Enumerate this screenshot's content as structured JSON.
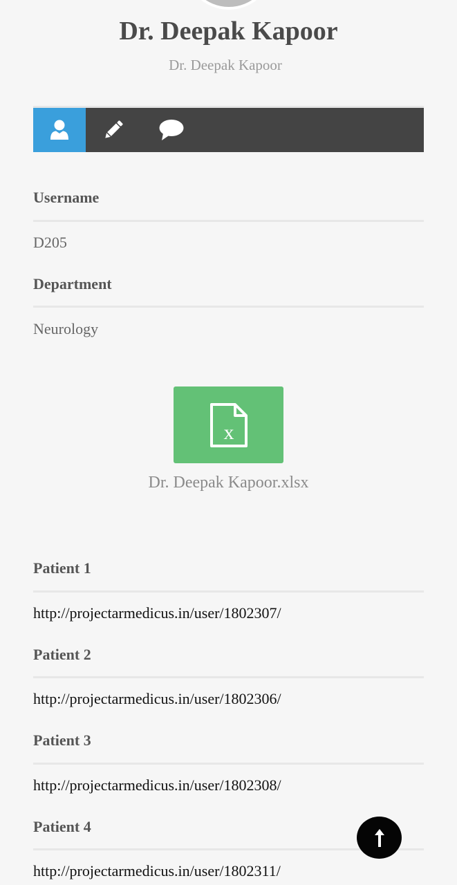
{
  "profile": {
    "name": "Dr. Deepak Kapoor",
    "subtitle": "Dr. Deepak Kapoor"
  },
  "tabs": [
    {
      "icon": "user-icon",
      "active": true
    },
    {
      "icon": "pencil-icon",
      "active": false
    },
    {
      "icon": "comment-icon",
      "active": false
    }
  ],
  "info": {
    "username_label": "Username",
    "username_value": "D205",
    "department_label": "Department",
    "department_value": "Neurology"
  },
  "attachment": {
    "icon": "excel-file-icon",
    "file_name": "Dr. Deepak Kapoor.xlsx"
  },
  "patients": [
    {
      "label": "Patient 1",
      "url": "http://projectarmedicus.in/user/1802307/"
    },
    {
      "label": "Patient 2",
      "url": "http://projectarmedicus.in/user/1802306/"
    },
    {
      "label": "Patient 3",
      "url": "http://projectarmedicus.in/user/1802308/"
    },
    {
      "label": "Patient 4",
      "url": "http://projectarmedicus.in/user/1802311/"
    }
  ],
  "colors": {
    "tab_active": "#3a9fdc",
    "tab_bar": "#444444",
    "file_tile": "#63c176",
    "page_background": "#f6f6f6"
  },
  "scroll_top": {
    "icon": "arrow-up-icon"
  }
}
